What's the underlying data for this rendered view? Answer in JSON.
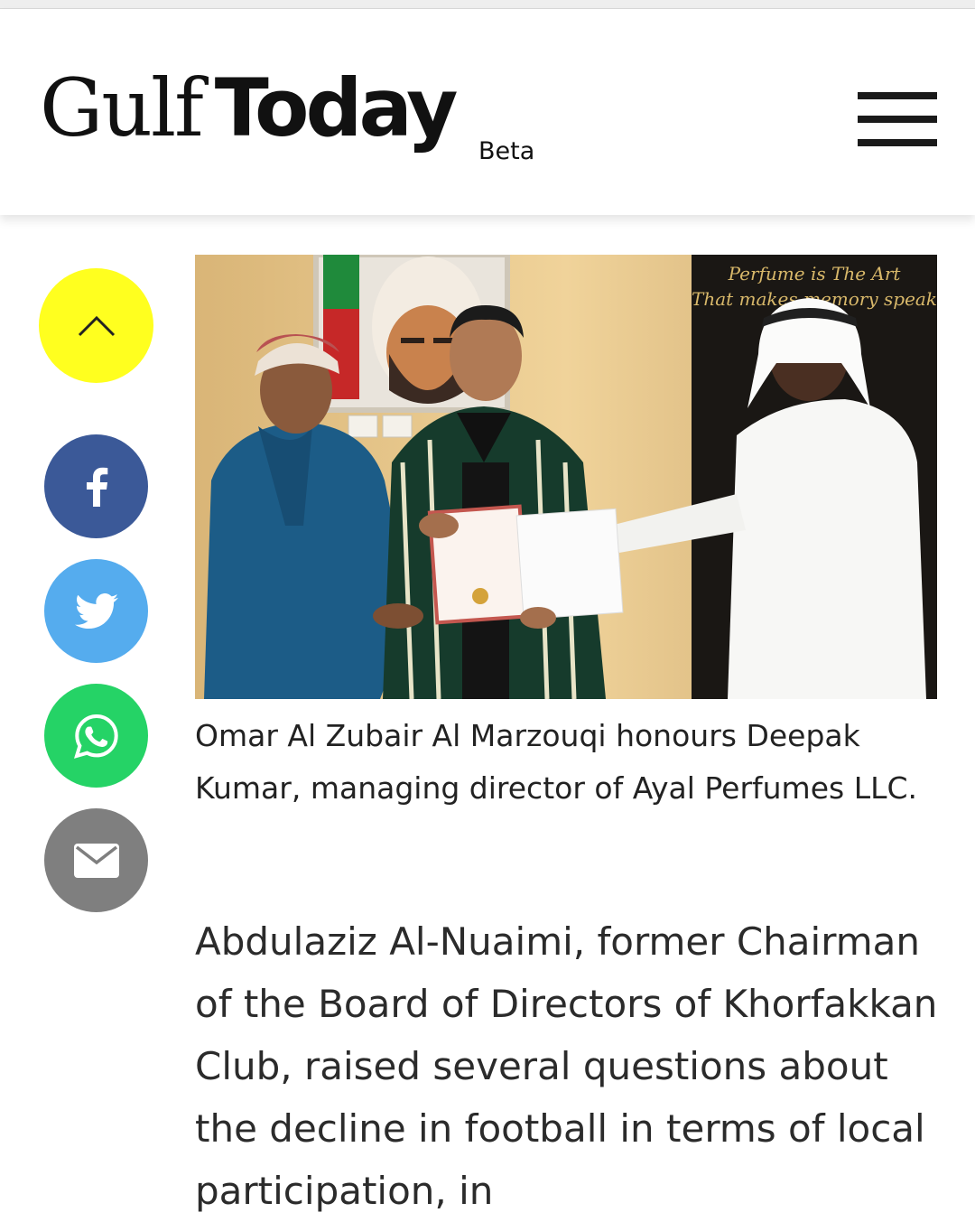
{
  "header": {
    "logo_gulf": "Gulf",
    "logo_today": "Today",
    "logo_badge": "Beta",
    "menu_icon": "hamburger-menu-icon"
  },
  "sidebar": {
    "scroll_top_icon": "chevron-up-icon",
    "share": [
      {
        "network": "facebook",
        "icon": "facebook-icon",
        "color": "#3b5998"
      },
      {
        "network": "twitter",
        "icon": "twitter-icon",
        "color": "#55acee"
      },
      {
        "network": "whatsapp",
        "icon": "whatsapp-icon",
        "color": "#25d366"
      },
      {
        "network": "email",
        "icon": "email-icon",
        "color": "#7f7f7f"
      }
    ],
    "scroll_top_color": "#ffff1f"
  },
  "article": {
    "photo_sign_line1": "Perfume is The Art",
    "photo_sign_line2": "That makes memory speak",
    "caption": " Omar Al Zubair Al Marzouqi honours Deepak Kumar, managing director of Ayal Perfumes LLC.",
    "body": "Abdulaziz Al-Nuaimi, former Chairman of the Board of Directors of Khorfakkan Club, raised several questions about the decline in football in terms of local participation, in"
  }
}
